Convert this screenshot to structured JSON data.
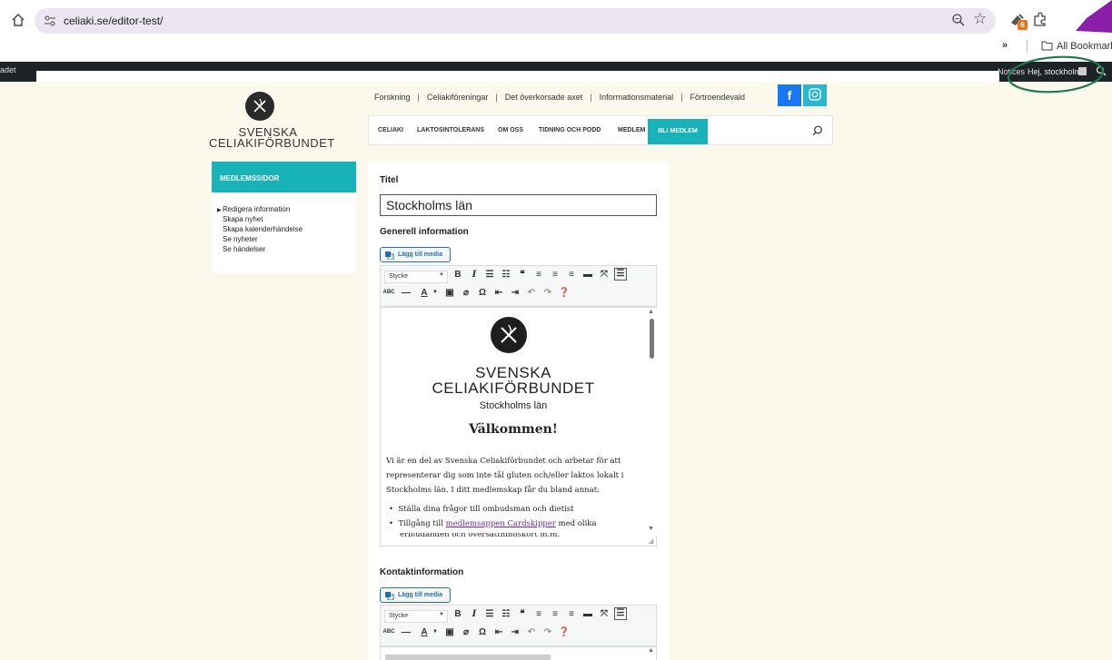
{
  "browser": {
    "url": "celiaki.se/editor-test/",
    "bookmarks_overflow": "»",
    "bookmarks_label": "All Bookmark",
    "extension_badge": "6"
  },
  "adminbar": {
    "left_text": "adet",
    "notices": "Notices",
    "greeting": "Hej, stockholm"
  },
  "site": {
    "logo_line1": "SVENSKA",
    "logo_line2": "CELIAKIFÖRBUNDET",
    "top_links": [
      "Forskning",
      "Celiakiföreningar",
      "Det överkorsade axet",
      "Informationsmaterial",
      "Förtroendevald"
    ],
    "facebook": "f",
    "main_nav": [
      "CELIAKI",
      "LAKTOSINTOLERANS",
      "OM OSS",
      "TIDNING OCH PODD",
      "MEDLEM"
    ],
    "main_nav_cta": "BLI MEDLEM"
  },
  "sidebar": {
    "heading": "MEDLEMSSIDOR",
    "items": [
      "Redigera information",
      "Skapa nyhet",
      "Skapa kalenderhändelse",
      "Se nyheter",
      "Se händelser"
    ]
  },
  "form": {
    "title_label": "Titel",
    "title_value": "Stockholms län",
    "general_label": "Generell information",
    "add_media_label": "Lägg till media",
    "format_select": "Stycke",
    "contact_label": "Kontaktinformation"
  },
  "editor": {
    "logo_line1": "SVENSKA",
    "logo_line2": "CELIAKIFÖRBUNDET",
    "logo_line3": "Stockholms län",
    "heading": "Välkommen!",
    "paragraph": "Vi är en del av Svenska Celiakiförbundet och arbetar för att representerar dig som inte tål gluten och/eller laktos lokalt i Stockholms län. I ditt medlemskap får du bland annat:",
    "bullet1": "Ställa dina frågor till ombudsman och dietist",
    "bullet2_pre": "Tillgång till ",
    "bullet2_link": "medlemsappen Cardskipper",
    "bullet2_post": " med olika",
    "bullet3": "erbjudanden och översättningskort m.m."
  },
  "colors": {
    "page_bg": "#fbf8ec",
    "accent": "#17b3b9",
    "adminbar": "#1d2327",
    "facebook": "#1877f2",
    "annotation_green": "#1f7a4a",
    "annotation_purple": "#8b1fa9"
  }
}
